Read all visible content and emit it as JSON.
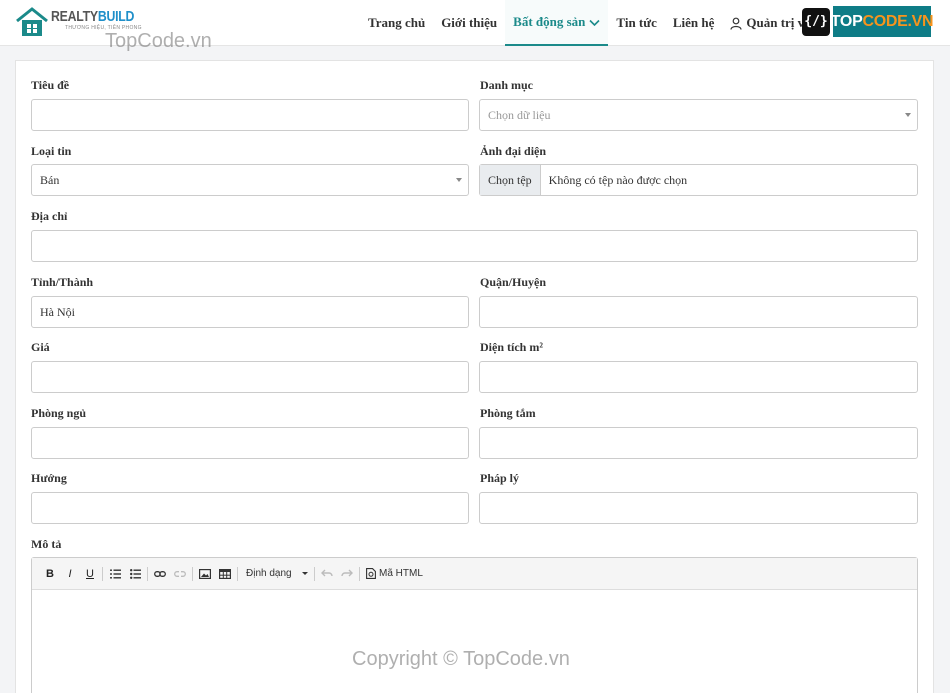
{
  "brand": {
    "name_part1": "REALTY",
    "name_part2": "BUILD",
    "slogan": "THƯƠNG HIỆU, TIÊN PHONG",
    "colors": {
      "accent": "#1b8a8a",
      "logo_blue": "#1f8fc9"
    }
  },
  "nav": {
    "items": [
      {
        "label": "Trang chủ"
      },
      {
        "label": "Giới thiệu"
      },
      {
        "label": "Bất động sản"
      },
      {
        "label": "Tin tức"
      },
      {
        "label": "Liên hệ"
      },
      {
        "label": "Quản trị viên"
      }
    ],
    "active_index": 2
  },
  "watermark": {
    "top": "TopCode.vn",
    "bottom": "Copyright © TopCode.vn",
    "badge_symbol": "{/}",
    "badge_part1": "TOP",
    "badge_part2": "CODE.VN"
  },
  "form": {
    "title": {
      "label": "Tiêu đề",
      "value": ""
    },
    "category": {
      "label": "Danh mục",
      "placeholder": "Chọn dữ liệu"
    },
    "listing_type": {
      "label": "Loại tin",
      "value": "Bán"
    },
    "avatar": {
      "label": "Ảnh đại diện",
      "button": "Chọn tệp",
      "status": "Không có tệp nào được chọn"
    },
    "address": {
      "label": "Địa chỉ",
      "value": ""
    },
    "province": {
      "label": "Tỉnh/Thành",
      "value": "Hà Nội"
    },
    "district": {
      "label": "Quận/Huyện",
      "value": ""
    },
    "price": {
      "label": "Giá",
      "value": ""
    },
    "area": {
      "label": "Diện tích m²",
      "value": ""
    },
    "bedrooms": {
      "label": "Phòng ngủ",
      "value": ""
    },
    "bathrooms": {
      "label": "Phòng tắm",
      "value": ""
    },
    "direction": {
      "label": "Hướng",
      "value": ""
    },
    "legal": {
      "label": "Pháp lý",
      "value": ""
    },
    "description": {
      "label": "Mô tả"
    }
  },
  "editor": {
    "bold": "B",
    "italic": "I",
    "underline": "U",
    "format_label": "Định dạng",
    "html_label": "Mã HTML"
  }
}
